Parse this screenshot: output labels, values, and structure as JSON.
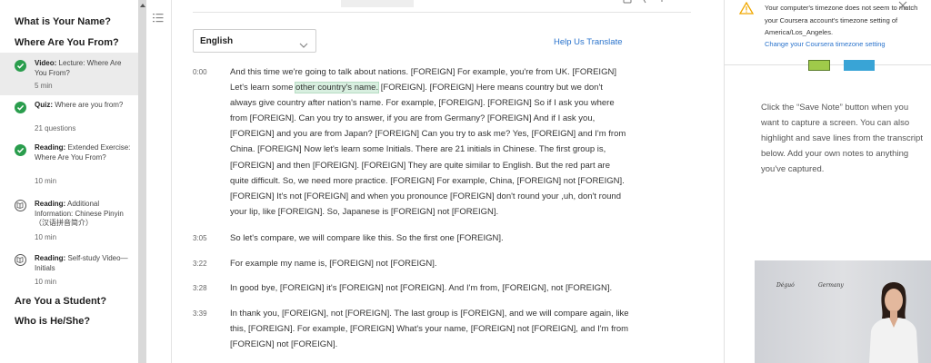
{
  "sidebar": {
    "sections": [
      {
        "title": "What is Your Name?"
      },
      {
        "title": "Where Are You From?"
      },
      {
        "title": "Are You a Student?"
      },
      {
        "title": "Who is He/She?"
      }
    ],
    "items": [
      {
        "kind": "Video:",
        "title": "Lecture: Where Are You From?",
        "sub": "5 min",
        "status": "completed",
        "active": true
      },
      {
        "kind": "Quiz:",
        "title": "Where are you from?",
        "sub": "21 questions",
        "status": "completed",
        "active": false
      },
      {
        "kind": "Reading:",
        "title": "Extended Exercise: Where Are You From?",
        "sub": "10 min",
        "status": "completed",
        "active": false
      },
      {
        "kind": "Reading:",
        "title": "Additional Information: Chinese Pinyin（汉语拼音简介）",
        "sub": "10 min",
        "status": "reading",
        "active": false
      },
      {
        "kind": "Reading:",
        "title": "Self-study Video—Initials",
        "sub": "10 min",
        "status": "reading",
        "active": false
      }
    ]
  },
  "transcript": {
    "language": "English",
    "help_translate": "Help Us Translate",
    "rows": [
      {
        "time": "0:00",
        "before": "And this time we're going to talk about nations. [FOREIGN] For example, you're from UK. [FOREIGN] Let's learn some ",
        "highlight": "other country's name.",
        "after": " [FOREIGN]. [FOREIGN] Here means country but we don't always give country after nation's name. For example, [FOREIGN]. [FOREIGN] So if I ask you where from [FOREIGN]. Can you try to answer, if you are from Germany? [FOREIGN] And if I ask you, [FOREIGN] and you are from Japan? [FOREIGN] Can you try to ask me? Yes, [FOREIGN] and I'm from China. [FOREIGN] Now let's learn some Initials. There are 21 initials in Chinese. The first group is, [FOREIGN] and then [FOREIGN]. [FOREIGN] They are quite similar to English. But the red part are quite difficult. So, we need more practice. [FOREIGN] For example, China, [FOREIGN] not [FOREIGN]. [FOREIGN] It's not [FOREIGN] and when you pronounce [FOREIGN] don't round your ,uh, don't round your lip, like [FOREIGN]. So, Japanese is [FOREIGN] not [FOREIGN]."
      },
      {
        "time": "3:05",
        "before": "So let's compare, we will compare like this. So the first one [FOREIGN].",
        "highlight": "",
        "after": ""
      },
      {
        "time": "3:22",
        "before": "For example my name is, [FOREIGN] not [FOREIGN].",
        "highlight": "",
        "after": ""
      },
      {
        "time": "3:28",
        "before": "In good bye, [FOREIGN] it's [FOREIGN] not [FOREIGN]. And I'm from, [FOREIGN], not [FOREIGN].",
        "highlight": "",
        "after": ""
      },
      {
        "time": "3:39",
        "before": "In thank you, [FOREIGN], not [FOREIGN]. The last group is [FOREIGN], and we will compare again, like this, [FOREIGN]. For example, [FOREIGN] What's your name, [FOREIGN] not [FOREIGN], and I'm from [FOREIGN] not [FOREIGN].",
        "highlight": "",
        "after": ""
      }
    ]
  },
  "right_panel": {
    "tz_message": "Your computer's timezone does not seem to match your Coursera account's timezone setting of America/Los_Angeles.",
    "tz_link": "Change your Coursera timezone setting",
    "note_help": "Click the “Save Note” button when you want to capture a screen. You can also highlight and save lines from the transcript below. Add your own notes to anything you've captured.",
    "video_caption_1": "Déguó",
    "video_caption_2": "Germany"
  },
  "colors": {
    "accent_link": "#2a73cc",
    "complete_green": "#2a9d4d",
    "highlight": "#d8efe0",
    "warning": "#f0a800"
  },
  "icons": [
    "check-icon",
    "reading-icon",
    "toc-icon",
    "chevron-down-icon",
    "warning-icon",
    "close-icon"
  ]
}
